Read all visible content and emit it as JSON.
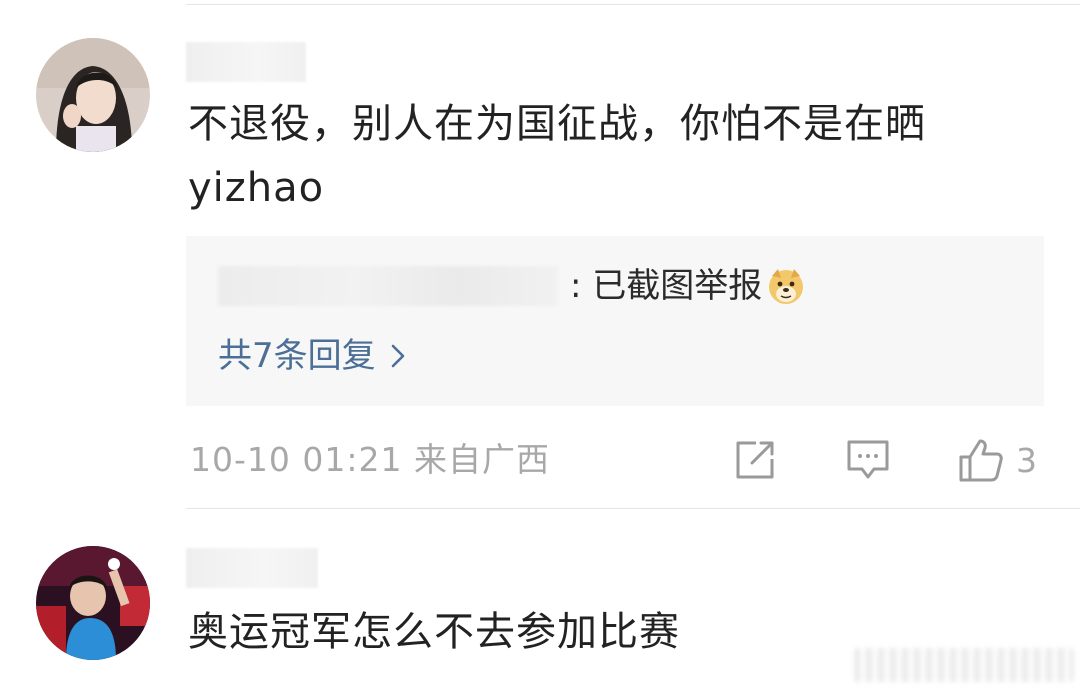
{
  "comments": [
    {
      "text_line1": "不退役，别人在为国征战，你怕不是在晒",
      "text_line2": "yizhao",
      "reply_preview": {
        "text": ": 已截图举报",
        "emoji": "doge-emoji"
      },
      "reply_count_label": "共7条回复",
      "meta": "10-10 01:21 来自广西",
      "like_count": "3"
    },
    {
      "text": "奥运冠军怎么不去参加比赛"
    }
  ],
  "icons": {
    "share": "share-icon",
    "comment": "comment-icon",
    "like": "thumbs-up-icon",
    "chevron": "chevron-right-icon"
  },
  "colors": {
    "link": "#4b6f97",
    "meta": "#a8a8a8",
    "reply_bg": "#f7f7f7"
  }
}
